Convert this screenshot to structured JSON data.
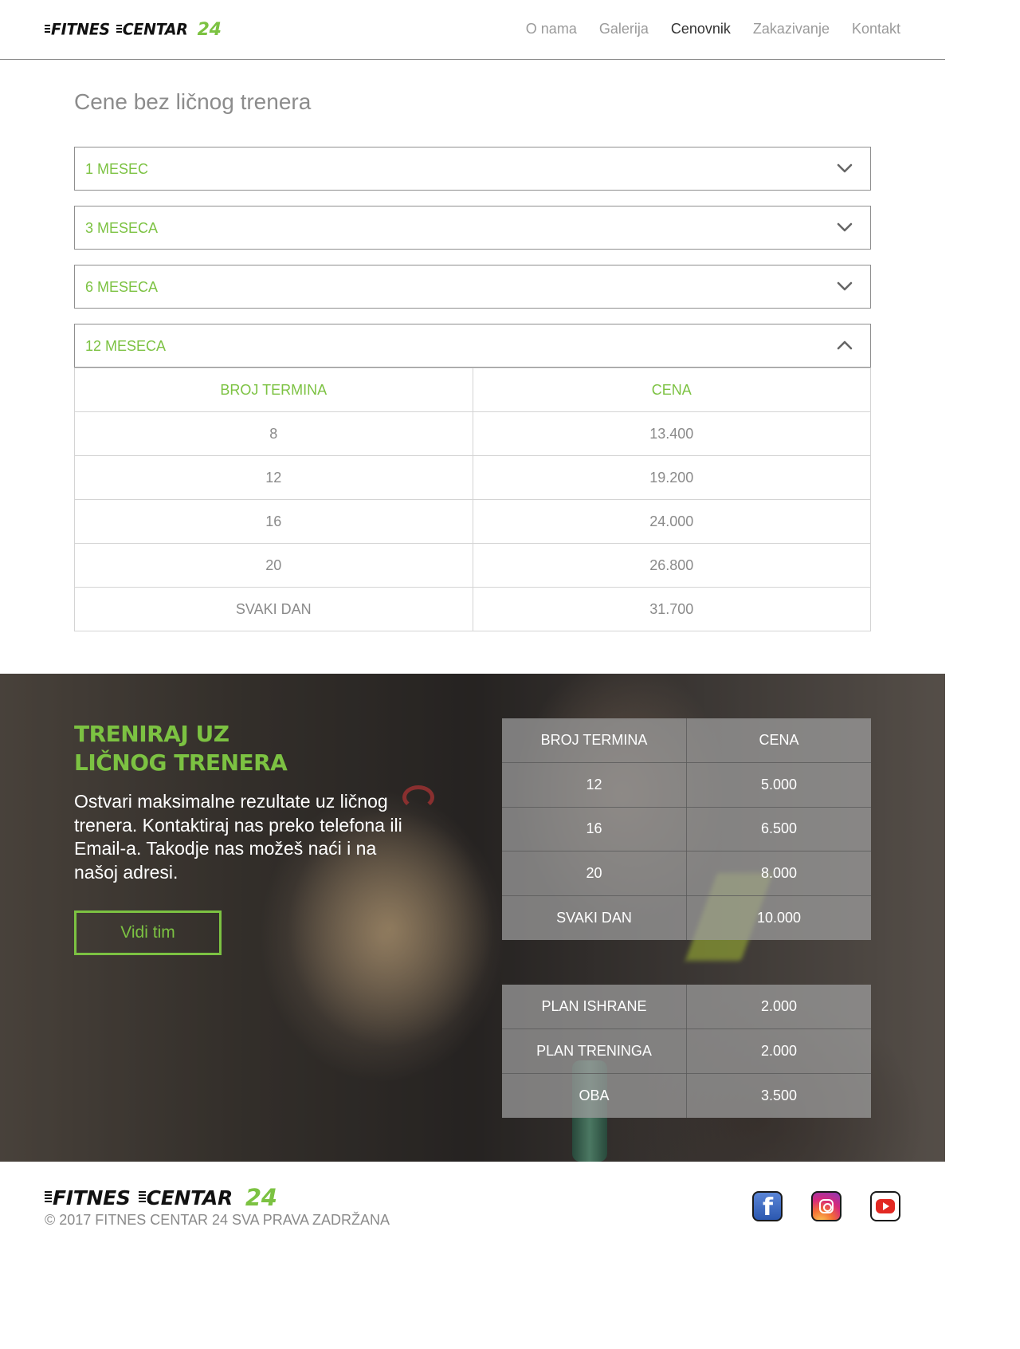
{
  "header": {
    "logo": {
      "word1": "FITNES",
      "word2": "CENTAR",
      "number": "24"
    },
    "nav": [
      {
        "label": "O nama",
        "active": false
      },
      {
        "label": "Galerija",
        "active": false
      },
      {
        "label": "Cenovnik",
        "active": true
      },
      {
        "label": "Zakazivanje",
        "active": false
      },
      {
        "label": "Kontakt",
        "active": false
      }
    ]
  },
  "prices": {
    "title": "Cene bez ličnog trenera",
    "accordion": [
      {
        "label": "1 MESEC",
        "expanded": false
      },
      {
        "label": "3 MESECA",
        "expanded": false
      },
      {
        "label": "6 MESECA",
        "expanded": false
      },
      {
        "label": "12 MESECA",
        "expanded": true
      }
    ],
    "table": {
      "headers": [
        "BROJ TERMINA",
        "CENA"
      ],
      "rows": [
        [
          "8",
          "13.400"
        ],
        [
          "12",
          "19.200"
        ],
        [
          "16",
          "24.000"
        ],
        [
          "20",
          "26.800"
        ],
        [
          "SVAKI DAN",
          "31.700"
        ]
      ]
    }
  },
  "trainer": {
    "title_line1": "TRENIRAJ UZ",
    "title_line2": "LIČNOG TRENERA",
    "text": "Ostvari maksimalne rezultate uz ličnog trenera. Kontaktiraj nas preko telefona ili Email-a. Takodje nas možeš naći i na našoj adresi.",
    "button_label": "Vidi tim",
    "sessions_table": {
      "headers": [
        "BROJ TERMINA",
        "CENA"
      ],
      "rows": [
        [
          "12",
          "5.000"
        ],
        [
          "16",
          "6.500"
        ],
        [
          "20",
          "8.000"
        ],
        [
          "SVAKI DAN",
          "10.000"
        ]
      ]
    },
    "plans_table": {
      "rows": [
        [
          "PLAN ISHRANE",
          "2.000"
        ],
        [
          "PLAN TRENINGA",
          "2.000"
        ],
        [
          "OBA",
          "3.500"
        ]
      ]
    }
  },
  "footer": {
    "logo": {
      "word1": "FITNES",
      "word2": "CENTAR",
      "number": "24"
    },
    "copyright": "© 2017  FITNES CENTAR 24 SVA PRAVA ZADRŽANA",
    "socials": [
      {
        "icon": "facebook-icon",
        "glyph": "f"
      },
      {
        "icon": "instagram-icon"
      },
      {
        "icon": "youtube-icon"
      }
    ]
  },
  "colors": {
    "accent": "#7cc242",
    "text_muted": "#8a8a8a",
    "nav_active": "#333333"
  }
}
